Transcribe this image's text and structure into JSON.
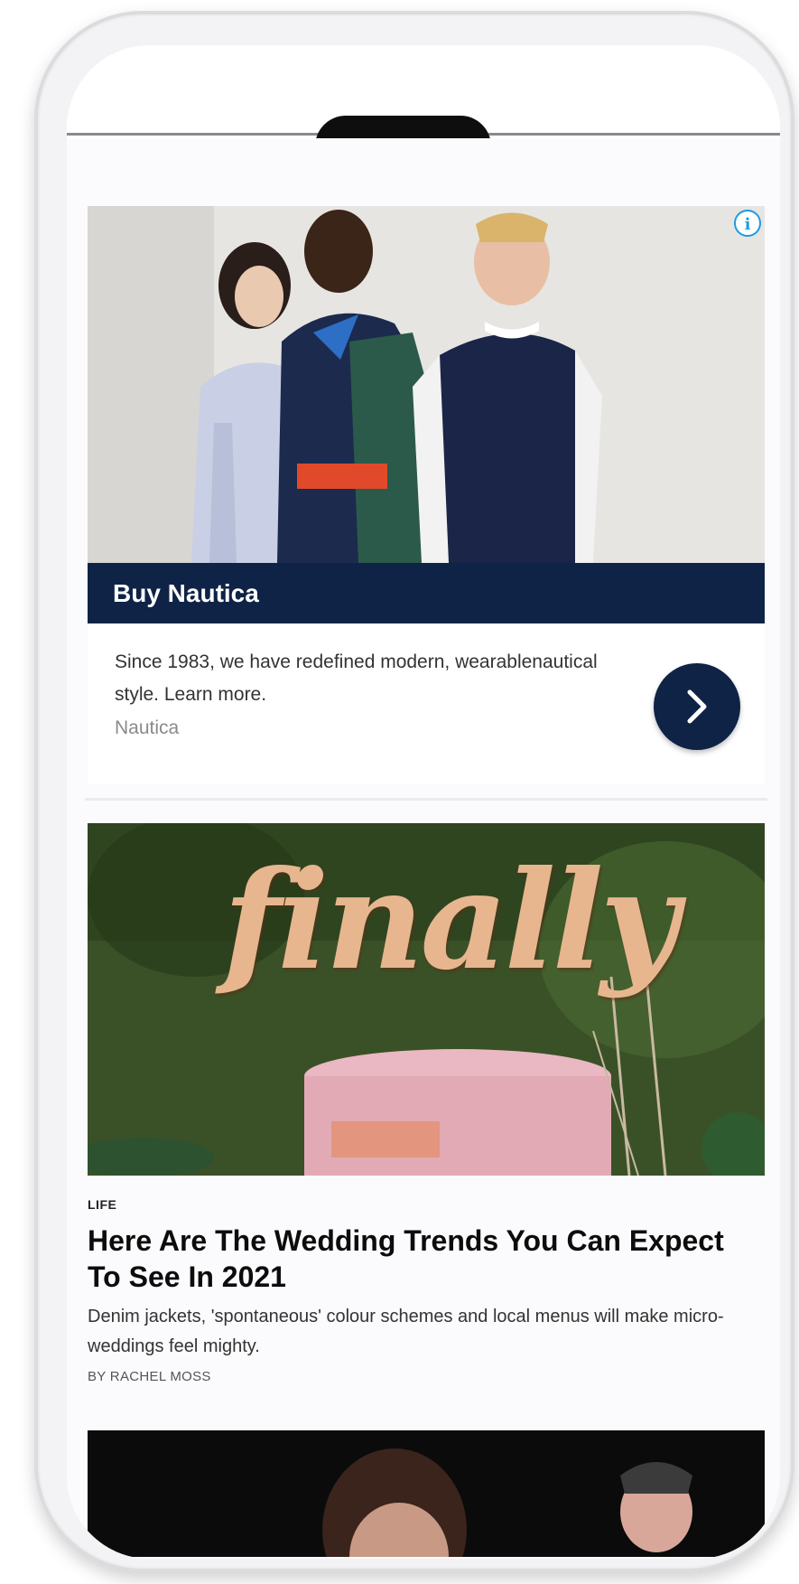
{
  "ad": {
    "info_icon": "info-icon",
    "title": "Buy Nautica",
    "description": "Since 1983, we have redefined modern, wearablenautical style. Learn more.",
    "advertiser": "Nautica",
    "cta_icon": "chevron-right-icon",
    "brand_color": "#0f2346"
  },
  "article": {
    "category": "LIFE",
    "title": "Here Are The Wedding Trends You Can Expect To See In 2021",
    "dek": "Denim jackets, 'spontaneous' colour schemes and local menus will make micro-weddings feel mighty.",
    "byline": "BY RACHEL MOSS",
    "image_word": "finally"
  }
}
